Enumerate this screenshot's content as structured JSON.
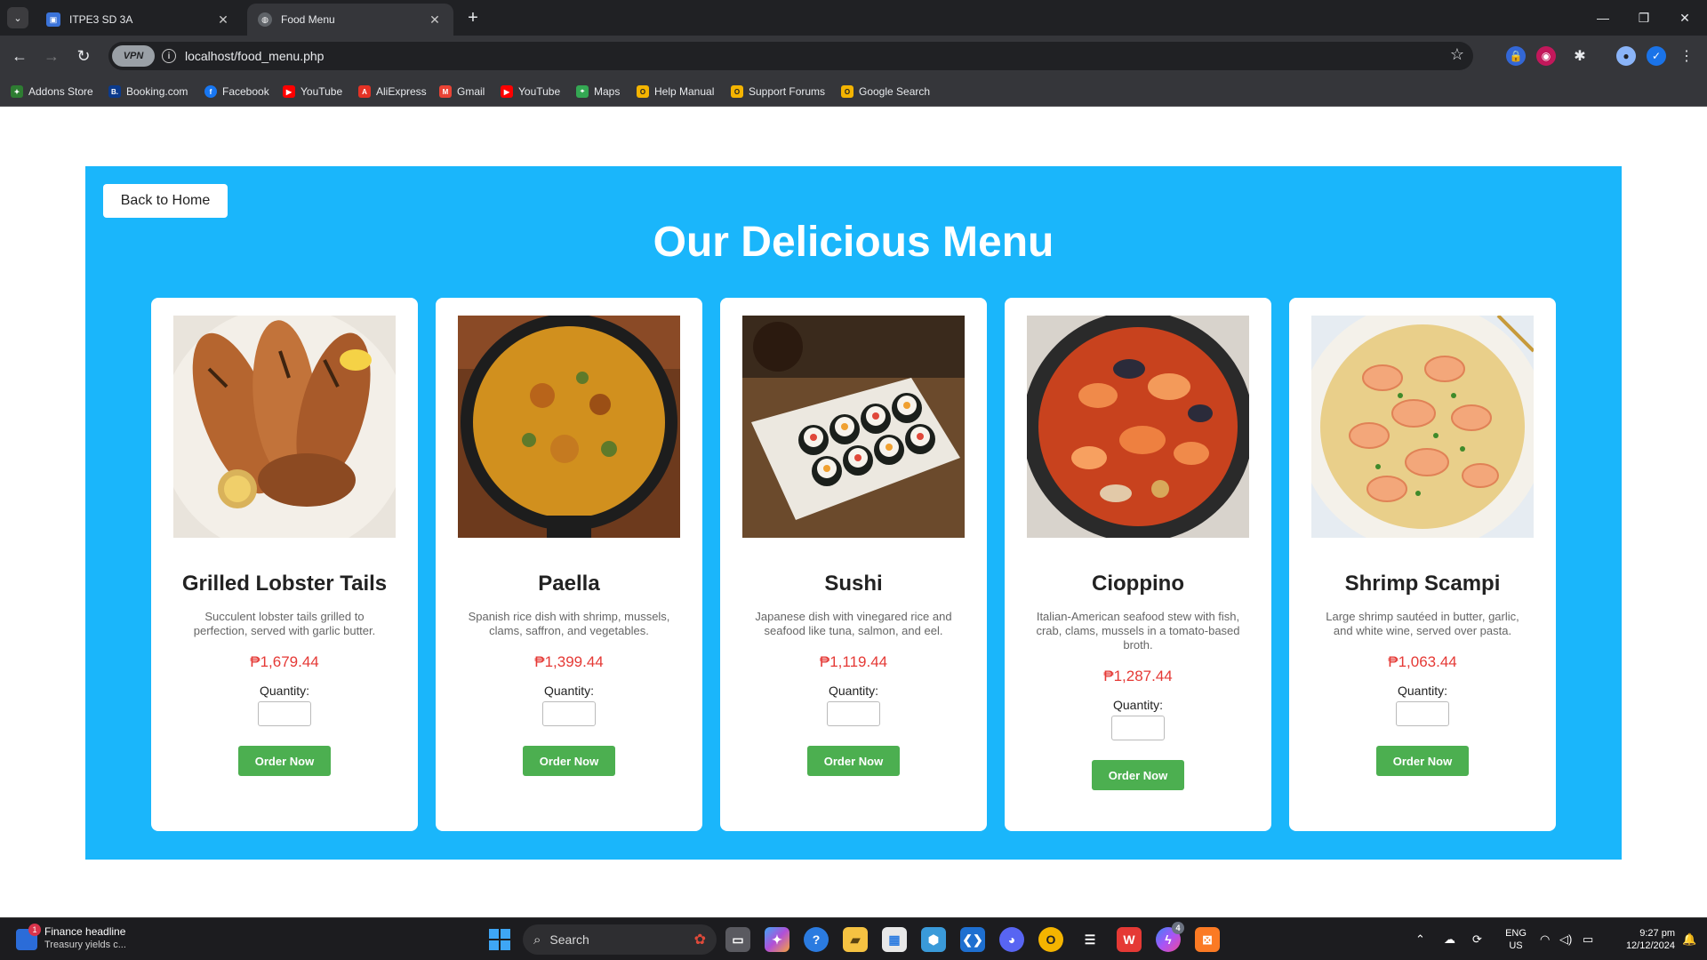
{
  "browser": {
    "tabs": [
      {
        "title": "ITPE3 SD 3A",
        "active": false
      },
      {
        "title": "Food Menu",
        "active": true
      }
    ],
    "url": "localhost/food_menu.php",
    "vpn_label": "VPN",
    "bookmarks": [
      {
        "label": "Addons Store",
        "icon": "addons-icon",
        "color": "#2e7d32"
      },
      {
        "label": "Booking.com",
        "icon": "booking-icon",
        "color": "#0b3a8c"
      },
      {
        "label": "Facebook",
        "icon": "facebook-icon",
        "color": "#1877f2"
      },
      {
        "label": "YouTube",
        "icon": "youtube-icon",
        "color": "#ff0000"
      },
      {
        "label": "AliExpress",
        "icon": "aliexpress-icon",
        "color": "#e43225"
      },
      {
        "label": "Gmail",
        "icon": "gmail-icon",
        "color": "#ea4335"
      },
      {
        "label": "YouTube",
        "icon": "youtube-icon",
        "color": "#ff0000"
      },
      {
        "label": "Maps",
        "icon": "maps-icon",
        "color": "#34a853"
      },
      {
        "label": "Help Manual",
        "icon": "opera-icon",
        "color": "#f4b400"
      },
      {
        "label": "Support Forums",
        "icon": "opera-icon",
        "color": "#f4b400"
      },
      {
        "label": "Google Search",
        "icon": "opera-icon",
        "color": "#f4b400"
      }
    ]
  },
  "page": {
    "back_label": "Back to Home",
    "title": "Our Delicious Menu",
    "accent_color": "#1ab6fb",
    "order_label": "Order Now",
    "quantity_label": "Quantity:",
    "items": [
      {
        "name": "Grilled Lobster Tails",
        "description": "Succulent lobster tails grilled to perfection, served with garlic butter.",
        "price": "₱1,679.44",
        "quantity": ""
      },
      {
        "name": "Paella",
        "description": "Spanish rice dish with shrimp, mussels, clams, saffron, and vegetables.",
        "price": "₱1,399.44",
        "quantity": ""
      },
      {
        "name": "Sushi",
        "description": "Japanese dish with vinegared rice and seafood like tuna, salmon, and eel.",
        "price": "₱1,119.44",
        "quantity": ""
      },
      {
        "name": "Cioppino",
        "description": "Italian-American seafood stew with fish, crab, clams, mussels in a tomato-based broth.",
        "price": "₱1,287.44",
        "quantity": ""
      },
      {
        "name": "Shrimp Scampi",
        "description": "Large shrimp sautéed in butter, garlic, and white wine, served over pasta.",
        "price": "₱1,063.44",
        "quantity": ""
      }
    ]
  },
  "taskbar": {
    "news_title": "Finance headline",
    "news_sub": "Treasury yields c...",
    "news_badge": "1",
    "search_label": "Search",
    "lang_top": "ENG",
    "lang_bottom": "US",
    "time": "9:27 pm",
    "date": "12/12/2024",
    "messenger_badge": "4"
  }
}
